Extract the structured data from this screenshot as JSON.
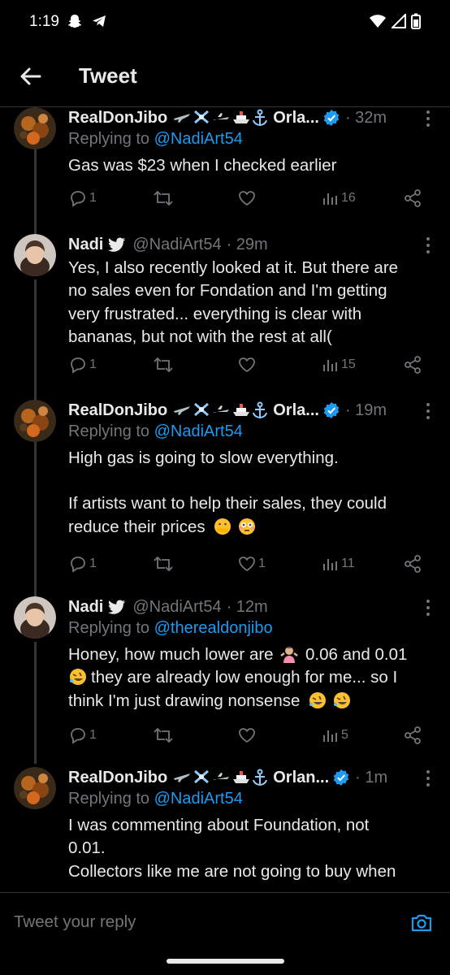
{
  "status_bar": {
    "time": "1:19"
  },
  "header": {
    "title": "Tweet"
  },
  "tweets": [
    {
      "name": "RealDonJibo",
      "name_suffix": "Orla...",
      "time": "· 32m",
      "reply_prefix": "Replying to",
      "reply_to": "@NadiArt54",
      "lines": [
        "Gas was $23 when I checked earlier"
      ],
      "replies": "1",
      "retweets": "",
      "likes": "",
      "views": "16"
    },
    {
      "name": "Nadi",
      "handle": "@NadiArt54",
      "time": "· 29m",
      "lines": [
        "Yes, I also recently looked at it. But there are",
        "no sales even for Fondation and I'm getting",
        "very frustrated... everything is clear with",
        "bananas, but not with the rest at all("
      ],
      "replies": "1",
      "retweets": "",
      "likes": "",
      "views": "15"
    },
    {
      "name": "RealDonJibo",
      "name_suffix": "Orla...",
      "time": "· 19m",
      "reply_prefix": "Replying to",
      "reply_to": "@NadiArt54",
      "line1": "High gas is going to slow everything.",
      "line2": "If artists want to help their sales, they could",
      "line3": "reduce their prices",
      "replies": "1",
      "retweets": "",
      "likes": "1",
      "views": "11"
    },
    {
      "name": "Nadi",
      "handle": "@NadiArt54",
      "time": "· 12m",
      "reply_prefix": "Replying to",
      "reply_to": "@therealdonjibo",
      "line1a": "Honey, how much lower are",
      "line1b": "0.06 and 0.01",
      "line2": "they are already low enough for me... so I",
      "line3": "think I'm just drawing nonsense",
      "replies": "1",
      "retweets": "",
      "likes": "",
      "views": "5"
    },
    {
      "name": "RealDonJibo",
      "name_suffix": "Orlan...",
      "time": "· 1m",
      "reply_prefix": "Replying to",
      "reply_to": "@NadiArt54",
      "lines": [
        "I was commenting about Foundation, not",
        "0.01.",
        "Collectors like me are not going to buy when"
      ]
    }
  ],
  "reply_bar": {
    "placeholder": "Tweet your reply"
  },
  "colors": {
    "accent": "#1d9bf0",
    "muted": "#71767b",
    "text": "#e7e9ea",
    "background": "#000000"
  }
}
